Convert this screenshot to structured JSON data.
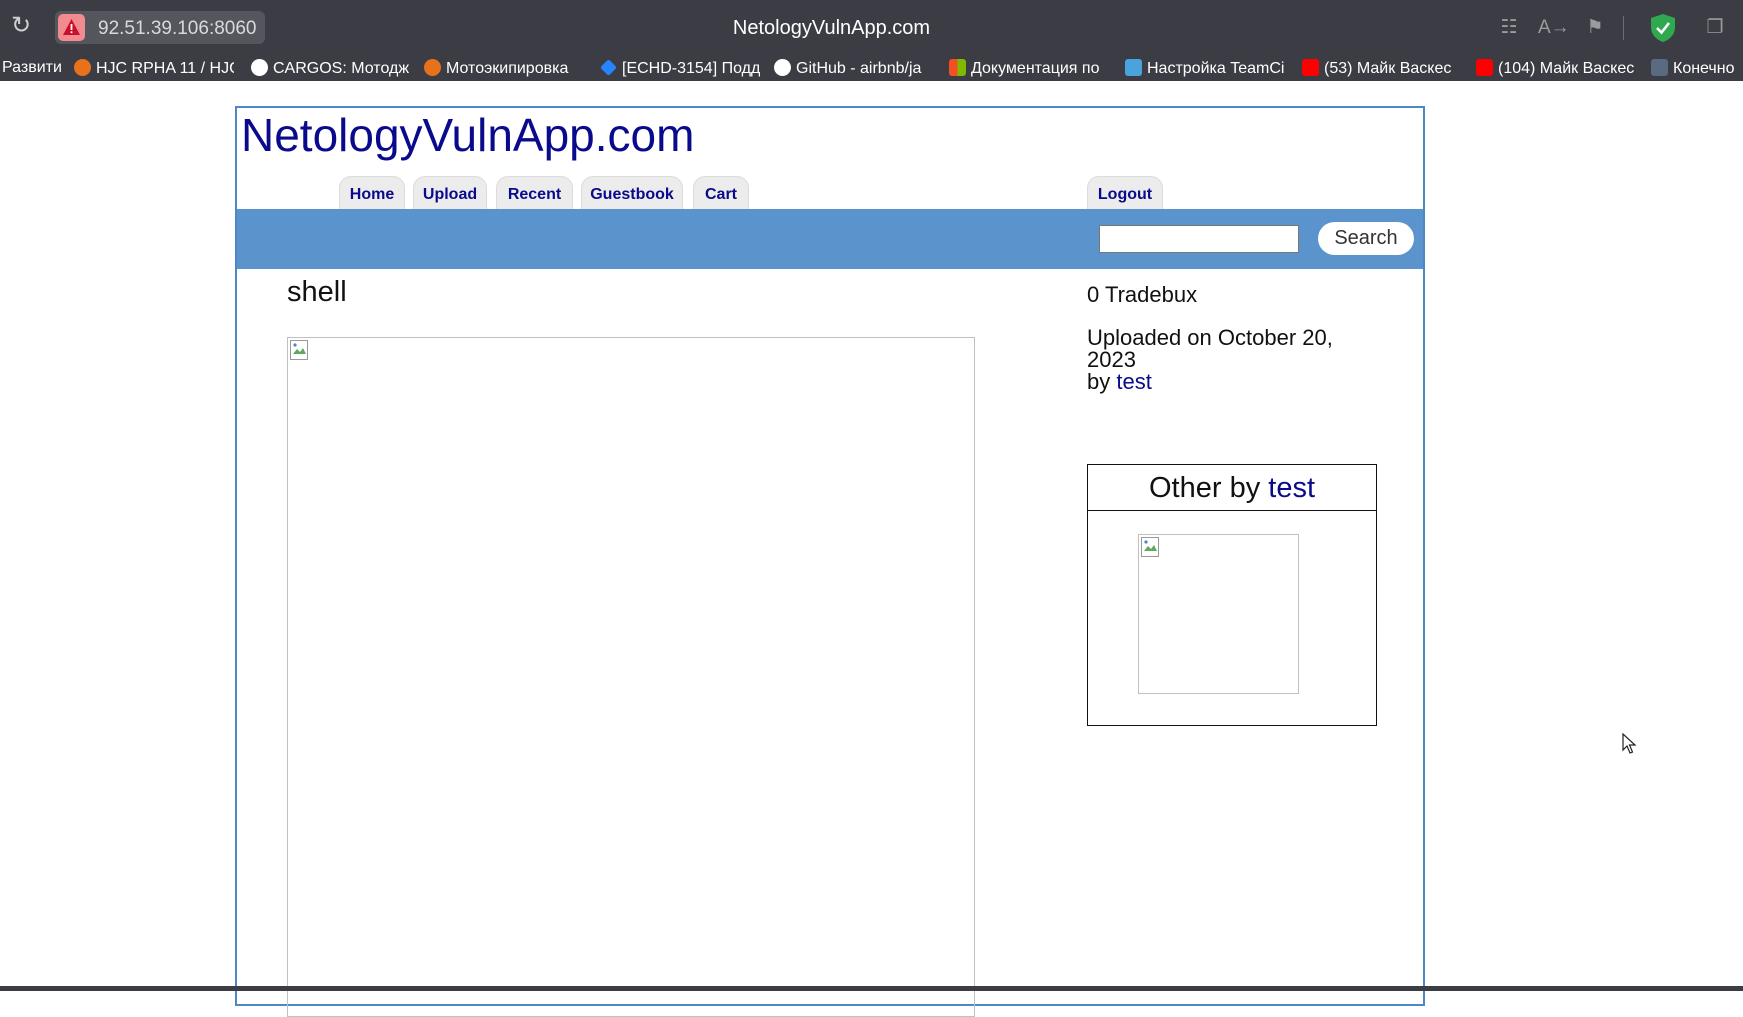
{
  "browser": {
    "url": "92.51.39.106:8060",
    "tab_title": "NetologyVulnApp.com",
    "bookmarks": [
      {
        "label": "Развити",
        "icon": "none"
      },
      {
        "label": "HJC RPHA 11 / HJC",
        "icon": "helmet-icon"
      },
      {
        "label": "CARGOS: Мотодж",
        "icon": "c-logo-icon"
      },
      {
        "label": "Мотоэкипировка",
        "icon": "helmet-icon"
      },
      {
        "label": "[ECHD-3154] Подд",
        "icon": "jira-icon"
      },
      {
        "label": "GitHub - airbnb/ja",
        "icon": "github-icon"
      },
      {
        "label": "Документация по",
        "icon": "microsoft-icon"
      },
      {
        "label": "Настройка TeamCi",
        "icon": "teamcity-icon"
      },
      {
        "label": "(53) Майк Васкес",
        "icon": "youtube-icon"
      },
      {
        "label": "(104) Майк Васкес",
        "icon": "youtube-icon"
      },
      {
        "label": "Конечно",
        "icon": "5d-icon"
      }
    ],
    "colors": {
      "chrome": "#3c3c44",
      "shield": "#2fa84f",
      "warning": "#f28b90"
    }
  },
  "site": {
    "title": "NetologyVulnApp.com",
    "nav": [
      "Home",
      "Upload",
      "Recent",
      "Guestbook",
      "Cart"
    ],
    "logout": "Logout",
    "search": {
      "value": "",
      "button": "Search"
    },
    "colors": {
      "link": "#0a0a8c",
      "band": "#5b93cd",
      "frame": "#4b88c5"
    }
  },
  "picture": {
    "title": "shell",
    "tradebux": "0 Tradebux",
    "uploaded_line1": "Uploaded on October 20,",
    "uploaded_line2": "2023",
    "by_prefix": "by",
    "author": "test"
  },
  "other": {
    "prefix": "Other by",
    "author": "test"
  }
}
